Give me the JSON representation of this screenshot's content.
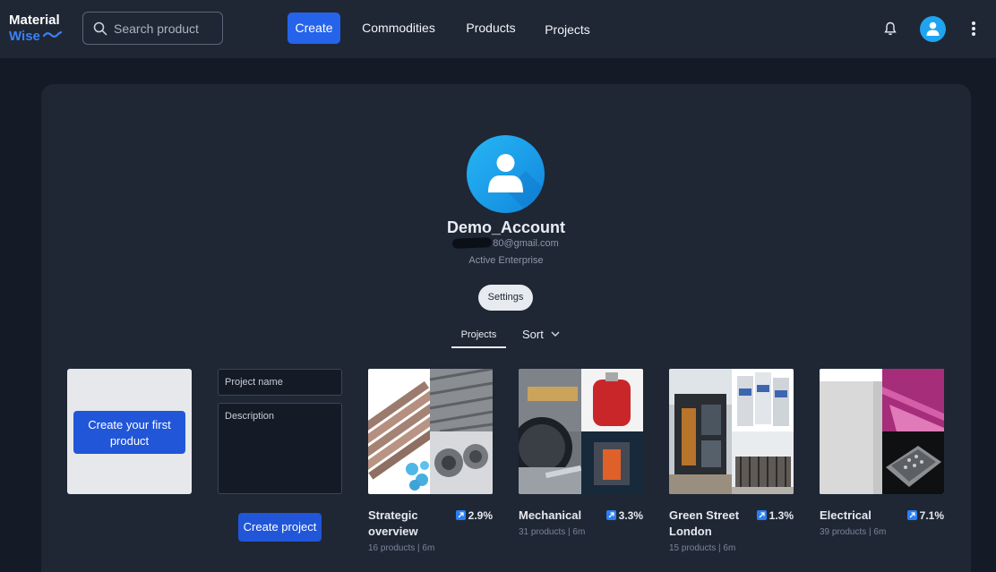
{
  "app": {
    "logo_line1": "Material",
    "logo_line2": "Wise",
    "brand_color": "#3b82f6"
  },
  "search": {
    "placeholder": "Search product",
    "icon": "search-icon"
  },
  "nav": {
    "create": "Create",
    "commodities": "Commodities",
    "products": "Products",
    "projects": "Projects"
  },
  "header_icons": [
    "bell-icon",
    "user-avatar-icon",
    "more-vertical-icon"
  ],
  "profile": {
    "name": "Demo_Account",
    "email": "80@gmail.com",
    "plan": "Active Enterprise",
    "settings_label": "Settings"
  },
  "tabs": {
    "projects": "Projects",
    "sort": "Sort"
  },
  "create_first_product": "Create your first product",
  "new_project": {
    "name_placeholder": "Project name",
    "description_placeholder": "Description",
    "create_label": "Create project"
  },
  "projects": [
    {
      "title": "Strategic overview",
      "change": "2.9%",
      "meta": "16 products | 6m"
    },
    {
      "title": "Mechanical",
      "change": "3.3%",
      "meta": "31 products | 6m"
    },
    {
      "title": "Green Street London",
      "change": "1.3%",
      "meta": "15 products | 6m"
    },
    {
      "title": "Electrical",
      "change": "7.1%",
      "meta": "39 products | 6m"
    }
  ],
  "accent_color": "#2563eb"
}
